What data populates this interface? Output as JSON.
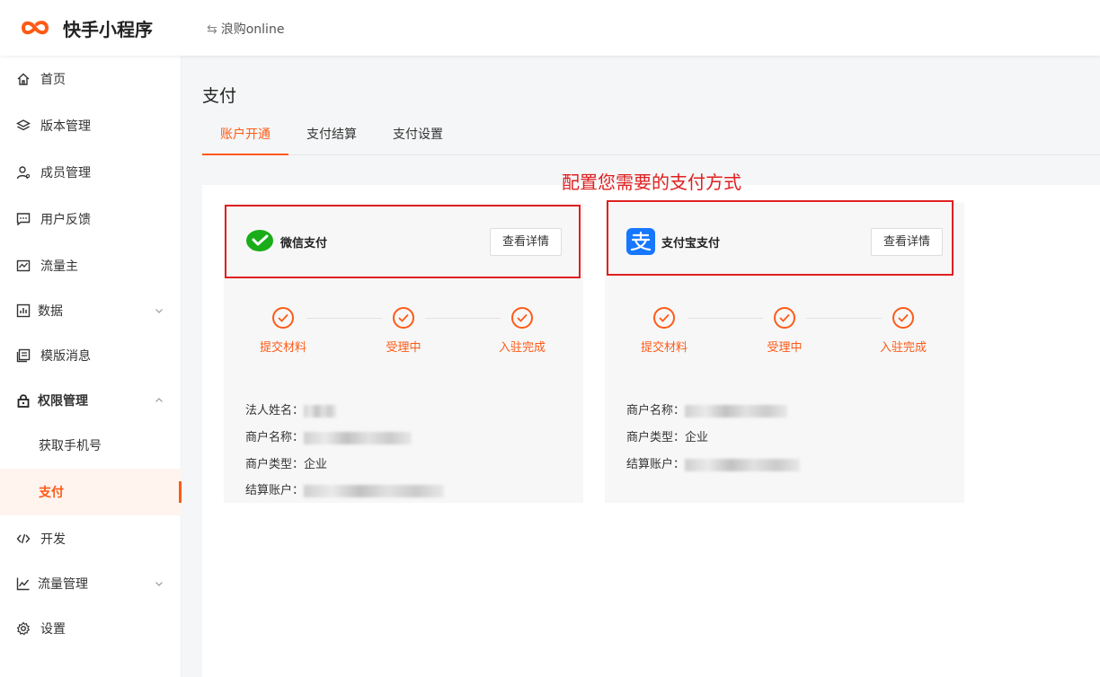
{
  "header": {
    "app_name": "快手小程序",
    "switch_icon": "⇆",
    "account_name": "浪购online"
  },
  "sidebar": {
    "items": [
      {
        "label": "首页",
        "icon": "home-icon"
      },
      {
        "label": "版本管理",
        "icon": "layers-icon"
      },
      {
        "label": "成员管理",
        "icon": "user-icon"
      },
      {
        "label": "用户反馈",
        "icon": "comment-icon"
      },
      {
        "label": "流量主",
        "icon": "traffic-icon"
      },
      {
        "label": "数据",
        "icon": "bar-chart-icon"
      },
      {
        "label": "模版消息",
        "icon": "copy-icon"
      },
      {
        "label": "权限管理",
        "icon": "lock-icon"
      },
      {
        "label": "获取手机号"
      },
      {
        "label": "支付"
      },
      {
        "label": "开发",
        "icon": "code-icon"
      },
      {
        "label": "流量管理",
        "icon": "line-chart-icon"
      },
      {
        "label": "设置",
        "icon": "gear-icon"
      }
    ]
  },
  "page": {
    "title": "支付",
    "tabs": [
      {
        "label": "账户开通"
      },
      {
        "label": "支付结算"
      },
      {
        "label": "支付设置"
      }
    ],
    "annotation": "配置您需要的支付方式"
  },
  "cards": {
    "wechat": {
      "name": "微信支付",
      "button": "查看详情",
      "steps": [
        "提交材料",
        "受理中",
        "入驻完成"
      ],
      "fields": [
        {
          "label": "法人姓名："
        },
        {
          "label": "商户名称："
        },
        {
          "label": "商户类型：",
          "value": "企业"
        },
        {
          "label": "结算账户："
        }
      ]
    },
    "alipay": {
      "name": "支付宝支付",
      "button": "查看详情",
      "steps": [
        "提交材料",
        "受理中",
        "入驻完成"
      ],
      "fields": [
        {
          "label": "商户名称："
        },
        {
          "label": "商户类型：",
          "value": "企业"
        },
        {
          "label": "结算账户："
        }
      ]
    }
  },
  "colors": {
    "accent": "#fe5a16",
    "annotation_red": "#e02020",
    "wechat_green": "#1aad19",
    "alipay_blue": "#1677ff"
  }
}
